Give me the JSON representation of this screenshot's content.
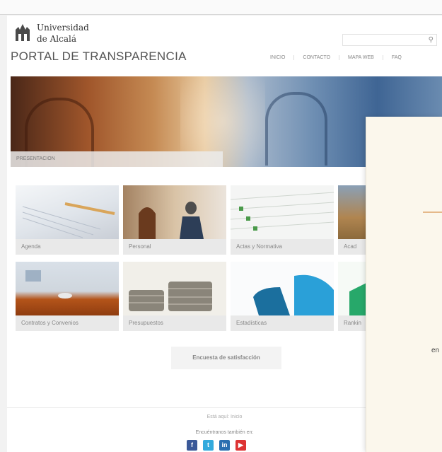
{
  "header": {
    "university_line1": "Universidad",
    "university_line2": "de Alcalá",
    "portal_title": "PORTAL DE TRANSPARENCIA",
    "search_placeholder": ""
  },
  "nav": {
    "items": [
      {
        "label": "INICIO"
      },
      {
        "label": "CONTACTO"
      },
      {
        "label": "MAPA WEB"
      },
      {
        "label": "FAQ"
      }
    ]
  },
  "banner": {
    "label": "PRESENTACION"
  },
  "tiles": [
    {
      "label": "Agenda"
    },
    {
      "label": "Personal"
    },
    {
      "label": "Actas y Normativa"
    },
    {
      "label": "Acad"
    },
    {
      "label": "Contratos y Convenios"
    },
    {
      "label": "Presupuestos"
    },
    {
      "label": "Estadísticas"
    },
    {
      "label": "Rankin"
    }
  ],
  "survey": {
    "label": "Encuesta de satisfacción"
  },
  "footer": {
    "here_text": "Está aquí: Inicio",
    "find_text": "Encuéntranos también en:",
    "social": [
      {
        "icon": "facebook-icon",
        "glyph": "f",
        "color": "#3b5998"
      },
      {
        "icon": "twitter-icon",
        "glyph": "t",
        "color": "#33aadd"
      },
      {
        "icon": "linkedin-icon",
        "glyph": "in",
        "color": "#2a6fb0"
      },
      {
        "icon": "youtube-icon",
        "glyph": "▶",
        "color": "#d33"
      }
    ]
  },
  "overlay": {
    "fragment_text": "en"
  }
}
